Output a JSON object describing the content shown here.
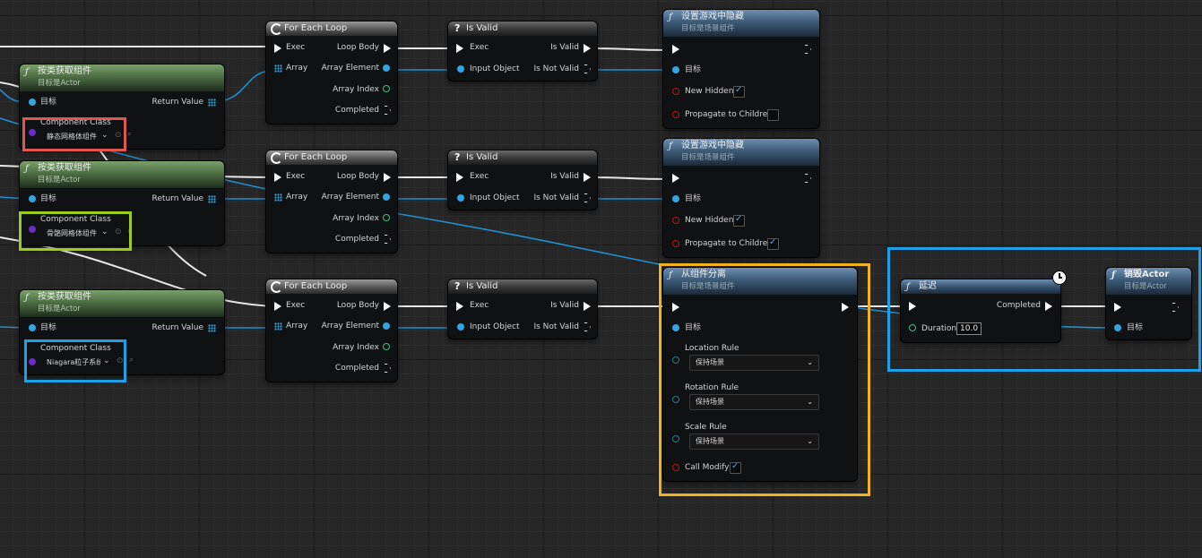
{
  "colors": {
    "exec": "#ffffff",
    "object": "#2fa6e3",
    "int": "#3ec48b",
    "bool": "#b01e1e",
    "class": "#6a2ec4",
    "red_box": "#e0574f",
    "green_box": "#9ccc1c",
    "blue_box": "#1ea0e8",
    "yellow_box": "#f0b21e"
  },
  "get_component": {
    "title": "按类获取组件",
    "subtitle": "目标是Actor",
    "target": "目标",
    "return_value": "Return Value",
    "component_class": "Component Class",
    "values": [
      "静态网格体组件",
      "骨骼网格体组件",
      "Niagara粒子系统"
    ]
  },
  "for_each": {
    "title": "For Each Loop",
    "exec": "Exec",
    "array": "Array",
    "loop_body": "Loop Body",
    "array_element": "Array Element",
    "array_index": "Array Index",
    "completed": "Completed"
  },
  "is_valid": {
    "title": "Is Valid",
    "exec": "Exec",
    "input_object": "Input Object",
    "is_valid": "Is Valid",
    "is_not_valid": "Is Not Valid"
  },
  "set_hidden": {
    "title": "设置游戏中隐藏",
    "subtitle": "目标是场景组件",
    "target": "目标",
    "new_hidden": "New Hidden",
    "propagate": "Propagate to Children"
  },
  "set_hidden_1": {
    "new_hidden": true,
    "propagate": false
  },
  "set_hidden_2": {
    "new_hidden": true,
    "propagate": true
  },
  "detach": {
    "title": "从组件分离",
    "subtitle": "目标是场景组件",
    "target": "目标",
    "location_rule": "Location Rule",
    "rotation_rule": "Rotation Rule",
    "scale_rule": "Scale Rule",
    "rule_value": "保持场景",
    "call_modify": "Call Modify",
    "call_modify_checked": true
  },
  "delay": {
    "title": "延迟",
    "completed": "Completed",
    "duration": "Duration",
    "duration_value": "10.0"
  },
  "destroy": {
    "title": "销毁Actor",
    "subtitle": "目标是Actor",
    "target": "目标"
  }
}
